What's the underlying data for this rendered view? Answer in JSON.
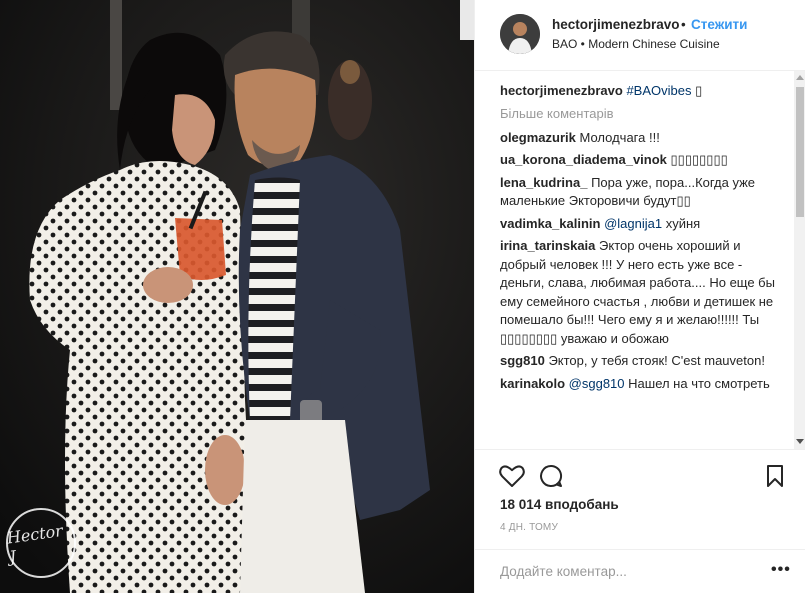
{
  "post": {
    "username": "hectorjimenezbravo",
    "separator": "•",
    "follow_label": "Стежити",
    "location": "BAO • Modern Chinese Cuisine"
  },
  "photo": {
    "watermark": "Hector J"
  },
  "caption": {
    "username": "hectorjimenezbravo",
    "hashtag": "#BAOvibes",
    "emoji": "▯"
  },
  "more_comments_label": "Більше коментарів",
  "comments": [
    {
      "user": "olegmazurik",
      "text": "Молодчага !!!"
    },
    {
      "user": "ua_korona_diadema_vinok",
      "text": "▯▯▯▯▯▯▯▯"
    },
    {
      "user": "lena_kudrina_",
      "text": "Пора уже, пора...Когда уже маленькие Экторовичи будут▯▯"
    },
    {
      "user": "vadimka_kalinin",
      "mention": "@lagnija1",
      "text": "хуйня"
    },
    {
      "user": "irina_tarinskaia",
      "text": "Эктор очень хороший и добрый человек !!! У него есть уже все - деньги, слава, любимая работа.... Но еще бы ему семейного счастья , любви и детишек не помешало бы!!! Чего ему я и желаю!!!!!! Ты ▯▯▯▯▯▯▯▯ уважаю и обожаю"
    },
    {
      "user": "sgg810",
      "text": "Эктор, у тебя стояк! C'est mauveton!"
    },
    {
      "user": "karinakolo",
      "mention": "@sgg810",
      "text": "Нашел на что смотреть"
    }
  ],
  "icons": {
    "like": "heart-icon",
    "comment": "comment-icon",
    "save": "bookmark-icon",
    "more": "more-options-icon"
  },
  "likes_label": "18 014 вподобань",
  "time_label": "4 ДН. ТОМУ",
  "add_comment": {
    "placeholder": "Додайте коментар...",
    "more_label": "•••"
  },
  "colors": {
    "accent": "#3897f0",
    "link": "#003569",
    "muted": "#999999",
    "text": "#262626"
  }
}
